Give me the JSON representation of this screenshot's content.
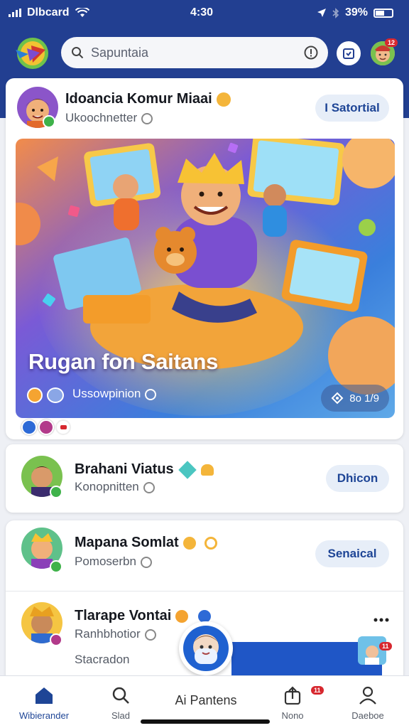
{
  "status_bar": {
    "carrier": "Dlbcard",
    "time": "4:30",
    "battery": "39%"
  },
  "header": {
    "search_text": "Sapuntaia",
    "notification_count": "12"
  },
  "feed": {
    "featured": {
      "name": "Idoancia Komur Miaai",
      "subtitle": "Ukoochnetter",
      "button": "I Satortial",
      "banner_title": "Rugan fon Saitans",
      "banner_subtitle": "Ussowpinion",
      "views": "8o 1/9",
      "colors": {
        "avatar_bg": "#8b55c9"
      }
    },
    "items": [
      {
        "name": "Brahani Viatus",
        "subtitle": "Konopnitten",
        "button": "Dhicon"
      },
      {
        "name": "Mapana Somlat",
        "subtitle": "Pomoserbn",
        "button": "Senaical"
      },
      {
        "name": "Tlarape Vontai",
        "subtitle": "Ranhbhotior",
        "extra": "Stacradon"
      }
    ]
  },
  "bottom_nav": {
    "items": [
      {
        "label": "Wibierander",
        "active": true
      },
      {
        "label": "Slad"
      },
      {
        "label": "Ai Pantens"
      },
      {
        "label": "Nono",
        "badge": "11"
      },
      {
        "label": "Daeboe"
      }
    ]
  },
  "theme": {
    "primary": "#223f91",
    "accent": "#1e4596",
    "badge_red": "#d7282f"
  }
}
